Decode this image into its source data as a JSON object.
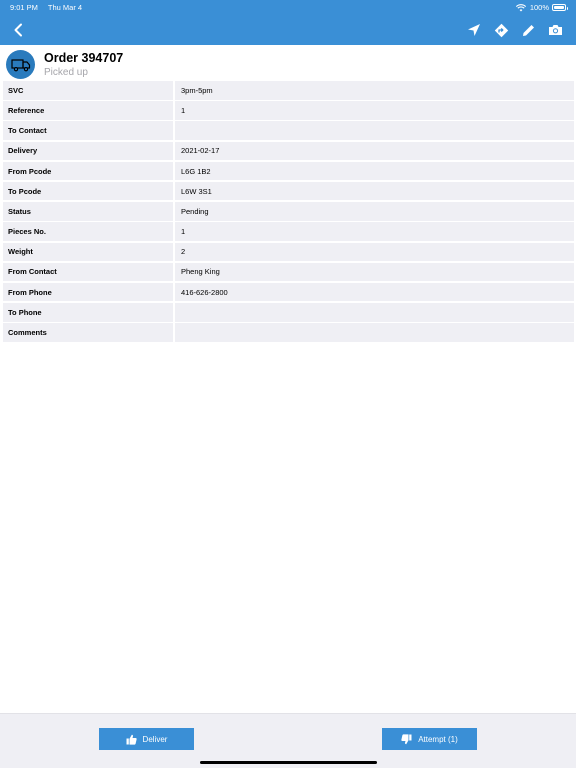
{
  "status_bar": {
    "time": "9:01 PM",
    "date": "Thu Mar 4",
    "battery": "100%"
  },
  "nav": {
    "back_icon": "chevron-left-icon",
    "actions": [
      "location-arrow-icon",
      "directions-icon",
      "pencil-icon",
      "camera-icon"
    ]
  },
  "order": {
    "title": "Order 394707",
    "status": "Picked up",
    "avatar_icon": "truck-icon"
  },
  "details": [
    {
      "label": "SVC",
      "value": "3pm-5pm"
    },
    {
      "label": "Reference",
      "value": "1"
    },
    {
      "label": "To Contact",
      "value": ""
    },
    {
      "label": "Delivery",
      "value": "2021-02-17"
    },
    {
      "label": "From Pcode",
      "value": "L6G 1B2"
    },
    {
      "label": "To Pcode",
      "value": "L6W 3S1"
    },
    {
      "label": "Status",
      "value": "Pending"
    },
    {
      "label": "Pieces No.",
      "value": "1"
    },
    {
      "label": "Weight",
      "value": "2"
    },
    {
      "label": "From Contact",
      "value": "Pheng King"
    },
    {
      "label": "From Phone",
      "value": "416-626-2800"
    },
    {
      "label": "To Phone",
      "value": ""
    },
    {
      "label": "Comments",
      "value": ""
    }
  ],
  "footer": {
    "deliver_label": "Deliver",
    "attempt_label": "Attempt (1)"
  },
  "colors": {
    "primary": "#3a8fd6",
    "avatar": "#2a7bbd",
    "row_bg": "#efeff4",
    "muted_text": "#a5a5aa"
  }
}
